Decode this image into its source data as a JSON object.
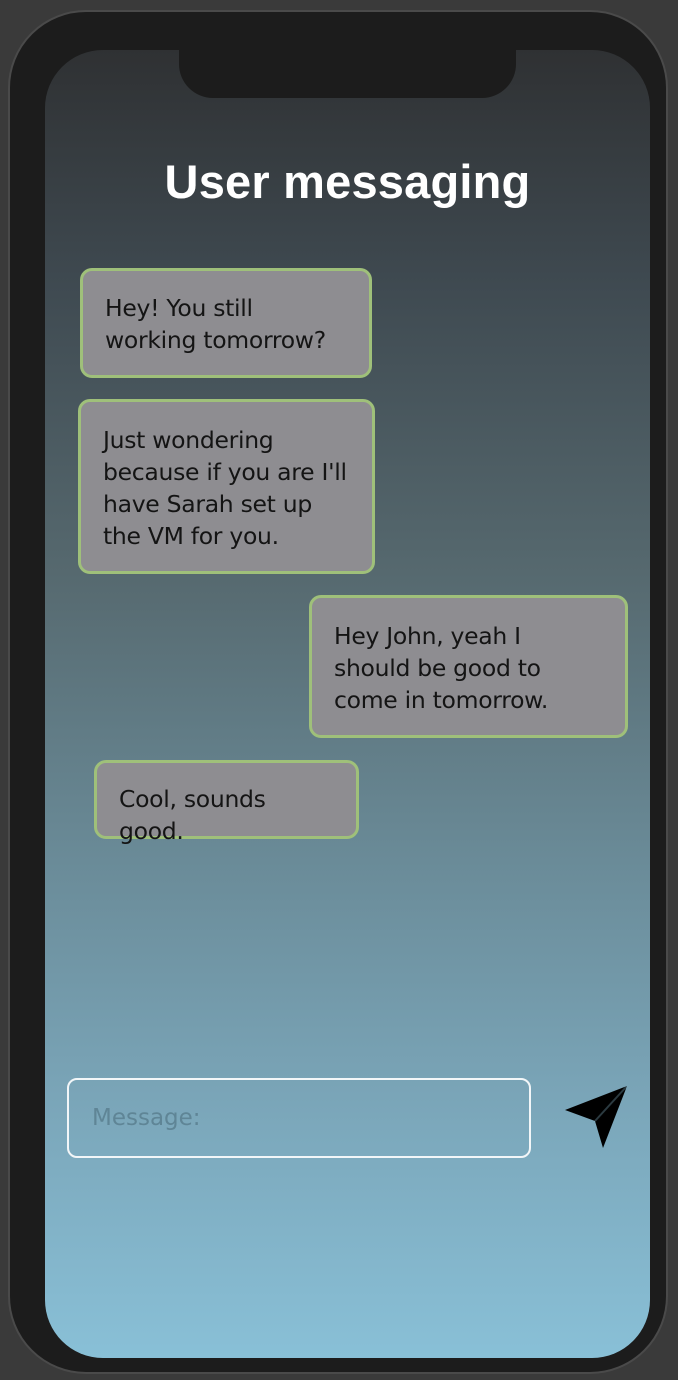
{
  "header": {
    "title": "User messaging"
  },
  "messages": [
    {
      "text": "Hey! You still working tomorrow?",
      "side": "left"
    },
    {
      "text": "Just wondering because if you are I'll have Sarah set up the VM for you.",
      "side": "left"
    },
    {
      "text": "Hey John, yeah I should be good to come in tomorrow.",
      "side": "right"
    },
    {
      "text": "Cool, sounds good.",
      "side": "left"
    }
  ],
  "composer": {
    "placeholder": "Message:",
    "value": "",
    "send_icon": "paper-plane-icon"
  },
  "colors": {
    "bubble_fill": "#8e8d91",
    "bubble_border": "#9fc07a",
    "title_text": "#ffffff",
    "gradient_top": "#2f3133",
    "gradient_bottom": "#89c0d7"
  }
}
